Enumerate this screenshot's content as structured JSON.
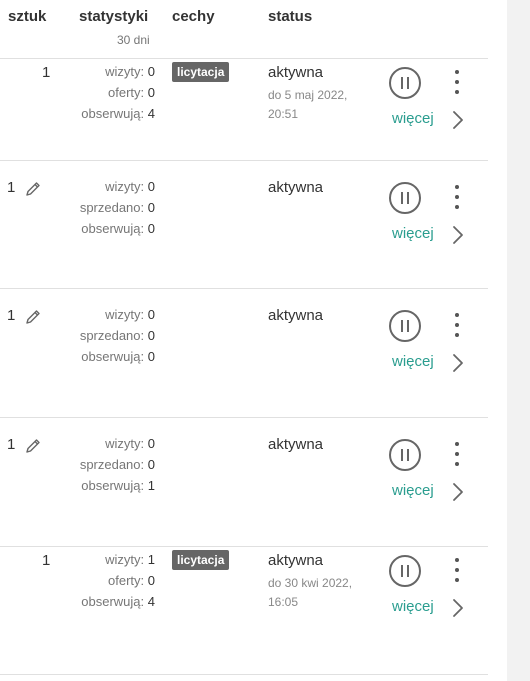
{
  "header": {
    "col_qty": "sztuk",
    "col_stats": "statystyki",
    "col_stats_sub": "30 dni",
    "col_features": "cechy",
    "col_status": "status"
  },
  "rows": [
    {
      "qty": "1",
      "stats": [
        [
          "wizyty:",
          "0"
        ],
        [
          "oferty:",
          "0"
        ],
        [
          "obserwują:",
          "4"
        ]
      ],
      "badge": "licytacja",
      "status": "aktywna",
      "until": "do 5 maj 2022, 20:51",
      "more": "więcej"
    },
    {
      "qty": "1",
      "stats": [
        [
          "wizyty:",
          "0"
        ],
        [
          "sprzedano:",
          "0"
        ],
        [
          "obserwują:",
          "0"
        ]
      ],
      "status": "aktywna",
      "more": "więcej"
    },
    {
      "qty": "1",
      "stats": [
        [
          "wizyty:",
          "0"
        ],
        [
          "sprzedano:",
          "0"
        ],
        [
          "obserwują:",
          "0"
        ]
      ],
      "status": "aktywna",
      "more": "więcej"
    },
    {
      "qty": "1",
      "stats": [
        [
          "wizyty:",
          "0"
        ],
        [
          "sprzedano:",
          "0"
        ],
        [
          "obserwują:",
          "1"
        ]
      ],
      "status": "aktywna",
      "more": "więcej"
    },
    {
      "qty": "1",
      "stats": [
        [
          "wizyty:",
          "1"
        ],
        [
          "oferty:",
          "0"
        ],
        [
          "obserwują:",
          "4"
        ]
      ],
      "badge": "licytacja",
      "status": "aktywna",
      "until": "do 30 kwi 2022, 16:05",
      "more": "więcej"
    }
  ],
  "icons": {
    "edit": "pencil-icon",
    "pause": "pause-icon",
    "menu": "kebab-menu-icon",
    "expand": "chevron-right-icon"
  },
  "colors": {
    "accent": "#2a9d8f",
    "badge": "#666666"
  }
}
